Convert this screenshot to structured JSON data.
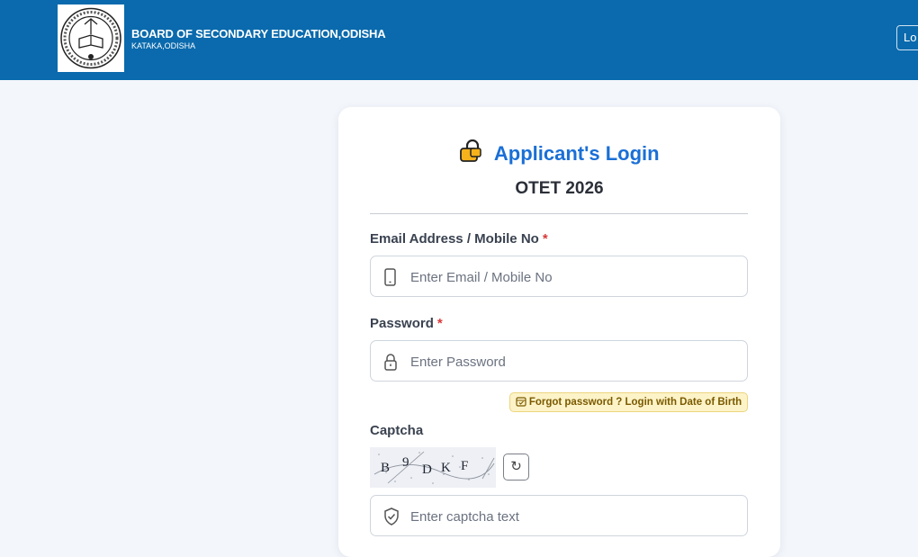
{
  "header": {
    "org_name": "BOARD OF SECONDARY EDUCATION,ODISHA",
    "org_sub": "KATAKA,ODISHA",
    "login_button": "Lo"
  },
  "login": {
    "title": "Applicant's Login",
    "exam": "OTET 2026",
    "email_label": "Email Address / Mobile No",
    "email_placeholder": "Enter Email / Mobile No",
    "password_label": "Password",
    "password_placeholder": "Enter Password",
    "required_mark": "*",
    "forgot_link": "Forgot password ? Login with Date of Birth",
    "captcha_label": "Captcha",
    "captcha_text": [
      "B",
      "9",
      "D",
      "K",
      "F"
    ],
    "captcha_placeholder": "Enter captcha text",
    "refresh_symbol": "↻"
  },
  "colors": {
    "header_bg": "#0a6aad",
    "title_blue": "#1a6fd6",
    "required_red": "#d93a3a",
    "forgot_bg": "#fdf3c8"
  }
}
